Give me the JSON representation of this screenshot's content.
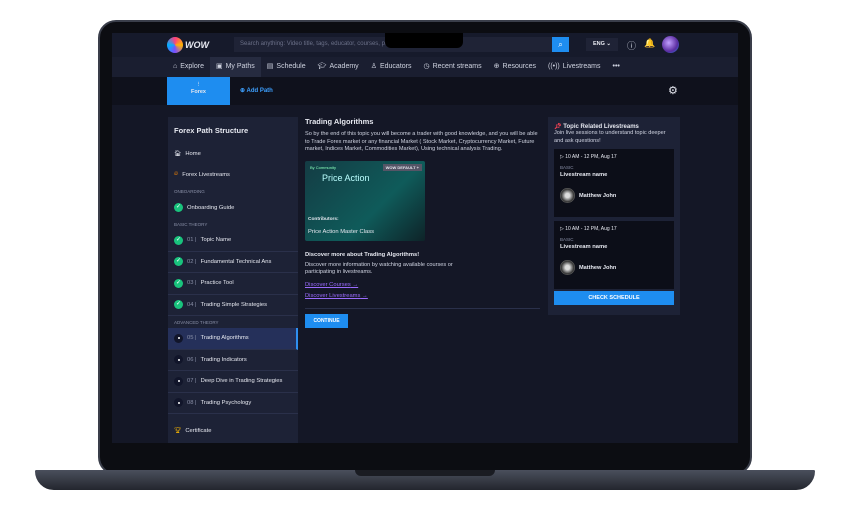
{
  "header": {
    "search_placeholder": "Search anything: Video title, tags, educator, courses, pl",
    "language": "ENG",
    "logo": "wow"
  },
  "nav": [
    "Explore",
    "My Paths",
    "Schedule",
    "Academy",
    "Educators",
    "Recent streams",
    "Resources",
    "Livestreams"
  ],
  "pathbar": {
    "active_path": "Forex",
    "add_path": "Add Path"
  },
  "sidebar": {
    "title": "Forex Path Structure",
    "home": "Home",
    "livestreams": "Forex Livestreams",
    "sections": {
      "onboarding": "ONBOARDING",
      "basic": "BASIC THEORY",
      "advanced": "ADVANCED THEORY"
    },
    "onboarding_item": "Onboarding Guide",
    "basic": [
      {
        "num": "01 |",
        "label": "Topic Name"
      },
      {
        "num": "02 |",
        "label": "Fundamental Technical Ans"
      },
      {
        "num": "03 |",
        "label": "Practice Tool"
      },
      {
        "num": "04 |",
        "label": "Trading Simple Strategies"
      }
    ],
    "advanced": [
      {
        "num": "05 |",
        "label": "Trading Algorithms"
      },
      {
        "num": "06 |",
        "label": "Trading Indicators"
      },
      {
        "num": "07 |",
        "label": "Deep Dive in Trading Strategies"
      },
      {
        "num": "08 |",
        "label": "Trading Psychology"
      }
    ],
    "certificate": "Certificate"
  },
  "main": {
    "title": "Trading Algorithms",
    "description": "So by the end of this topic you will become a trader with good knowledge, and you will be able to Trade Forex market or any financial Market ( Stock Market, Cryptocurrency Market, Future market, Indices Market, Commodities Market), Using technical analysis Trading.",
    "course": {
      "badge": "By Community",
      "wow_default": "WOW DEFAULT +",
      "title": "Price Action",
      "contributors": "Contributors:",
      "name": "Price Action Master Class"
    },
    "discover_title": "Discover more about Trading Algorithms!",
    "discover_text": "Discover more information by watching available courses or participating in livestreams.",
    "discover_courses": "Discover Courses",
    "discover_livestreams": "Discover Livestreams",
    "continue": "CONTINUE"
  },
  "right": {
    "title": "Topic Related Livestreams",
    "subtitle": "Join live sessions to understand topic deeper and ask questions!",
    "streams": [
      {
        "time": "10 AM - 12 PM, Aug 17",
        "level": "BASIC",
        "name": "Livestream name",
        "host": "Matthew John"
      },
      {
        "time": "10 AM - 12 PM, Aug 17",
        "level": "BASIC",
        "name": "Livestream name",
        "host": "Matthew John"
      }
    ],
    "check_schedule": "CHECK SCHEDULE"
  }
}
